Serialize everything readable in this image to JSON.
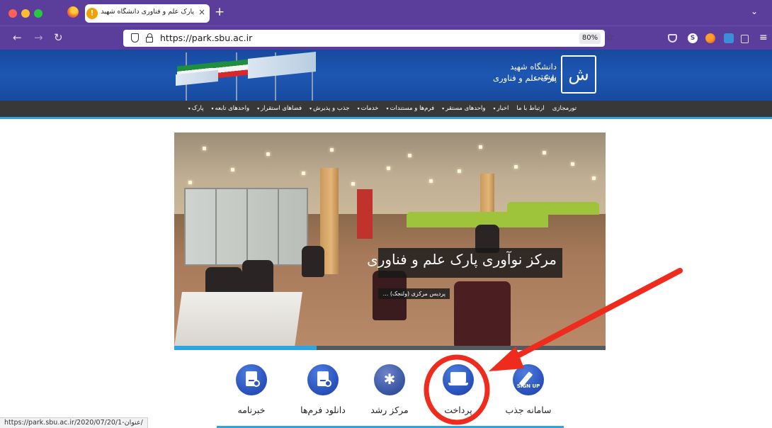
{
  "browser": {
    "tab_title": "پارک علم و فناوری دانشگاه شهید بهشتی",
    "tab_favicon": "!",
    "new_tab_glyph": "+",
    "close_glyph": "×",
    "url": "https://park.sbu.ac.ir",
    "zoom": "80%",
    "status_url": "https://park.sbu.ac.ir/2020/07/20/1-عنوان/",
    "extensions": [
      "pocket-icon",
      "s-extension-icon",
      "firefox-extension-icon",
      "translate-icon",
      "share-icon"
    ]
  },
  "header": {
    "university_name": "دانشگاه شهید بهشتی",
    "park_name": "پارک علم و فناوری",
    "logo_glyph": "ش"
  },
  "nav": {
    "items": [
      {
        "label": "پارک",
        "has_dropdown": true
      },
      {
        "label": "واحدهای تابعه",
        "has_dropdown": true
      },
      {
        "label": "فضاهای استقرار",
        "has_dropdown": true
      },
      {
        "label": "جذب و پذیرش",
        "has_dropdown": true
      },
      {
        "label": "خدمات",
        "has_dropdown": true
      },
      {
        "label": "فرم‌ها و مستندات",
        "has_dropdown": true
      },
      {
        "label": "واحدهای مستقر",
        "has_dropdown": true
      },
      {
        "label": "اخبار",
        "has_dropdown": true
      },
      {
        "label": "ارتباط با ما",
        "has_dropdown": false
      },
      {
        "label": "تورمجازی",
        "has_dropdown": false
      }
    ],
    "caret_glyph": "▾"
  },
  "slider": {
    "title": "مرکز نوآوری پارک علم و فناوری",
    "subtitle": "پردیس مرکزی (ولنجک) ...",
    "progress": 0.33
  },
  "quick_links": [
    {
      "label": "خبرنامه",
      "icon": "newsletter-download-icon"
    },
    {
      "label": "دانلود فرم‌ها",
      "icon": "forms-download-icon"
    },
    {
      "label": "مرکز رشد",
      "icon": "growth-center-icon"
    },
    {
      "label": "پرداخت",
      "icon": "payment-laptop-icon"
    },
    {
      "label": "سامانه جذب",
      "icon": "signup-icon"
    }
  ],
  "signup_badge": "SIGN UP",
  "growth_glyph": "✱",
  "colors": {
    "browser_chrome": "#5b3d9c",
    "header_blue": "#1d57b3",
    "nav_dark": "#383838",
    "accent_cyan": "#2ea5e0",
    "annotation_red": "#ee2b1c"
  }
}
